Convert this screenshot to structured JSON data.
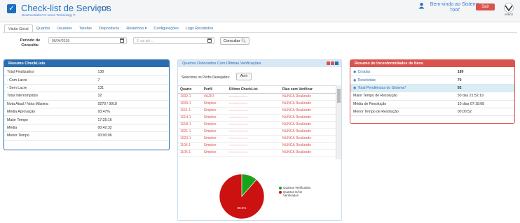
{
  "header": {
    "title": "Check-list de Serviços",
    "version": "v1.5",
    "subtitle": "Desenvolvido Por Vorce Technology ®",
    "welcome": "Bem-vindo ao Sistema 'root'",
    "logout_label": "Sair",
    "brand_logo": "VORCE"
  },
  "nav": {
    "tabs": [
      "Visão Geral",
      "Quartos",
      "Usuários",
      "Tarefas",
      "Dispositivos",
      "Relatórios ▾",
      "Configurações",
      "Logs Recebidos"
    ],
    "active_index": 0
  },
  "filter": {
    "period_label": "Período de Consulta:",
    "start_date": "06/04/2018",
    "end_placeholder": "E vai até ...",
    "consult_label": "Consultar"
  },
  "summary": {
    "title": "Resumo CheckLists",
    "rows": [
      {
        "label": "Total Finalizados",
        "value": "138"
      },
      {
        "label": "- Com Lacre",
        "value": "7"
      },
      {
        "label": "- Sem Lacre",
        "value": "131"
      },
      {
        "label": "Total Interrompidos",
        "value": "32"
      },
      {
        "label": "Nota Atual / Nota Máxima",
        "value": "9270 / 9918"
      },
      {
        "label": "Média Aprovação",
        "value": "93.47%"
      },
      {
        "label": "Maior Tempo",
        "value": "17:25:16"
      },
      {
        "label": "Média",
        "value": "00:42:32"
      },
      {
        "label": "Menor Tempo",
        "value": "00:00:06"
      }
    ]
  },
  "rooms": {
    "title": "Quartos Ordenados Com Últimas Verificações",
    "select_label": "Selecione os Perfis Desejados:",
    "open_label": "Abrir",
    "columns": [
      "Quarto",
      "Perfil",
      "Último CheckList",
      "Dias sem Verificar"
    ],
    "rows": [
      {
        "room": "1002-1",
        "profile": "VAZIO",
        "last": "----------------",
        "days": "NUNCA Realizado"
      },
      {
        "room": "1009-1",
        "profile": "Simples",
        "last": "----------------",
        "days": "NUNCA Realizado"
      },
      {
        "room": "1011-1",
        "profile": "Simples",
        "last": "----------------",
        "days": "NUNCA Realizado"
      },
      {
        "room": "1014-1",
        "profile": "Simples",
        "last": "----------------",
        "days": "NUNCA Realizado"
      },
      {
        "room": "1018-1",
        "profile": "Simples",
        "last": "----------------",
        "days": "NUNCA Realizado"
      },
      {
        "room": "1021-1",
        "profile": "Simples",
        "last": "----------------",
        "days": "NUNCA Realizado"
      },
      {
        "room": "1023-1",
        "profile": "Simples",
        "last": "----------------",
        "days": "NUNCA Realizado"
      },
      {
        "room": "1104-1",
        "profile": "Simples",
        "last": "----------------",
        "days": "NUNCA Realizado"
      },
      {
        "room": "1105-1",
        "profile": "Simples",
        "last": "----------------",
        "days": "NUNCA Realizado"
      }
    ],
    "pie": {
      "verified_pct": 0.114,
      "not_verified_label_value": "88.6%",
      "legend": [
        "Quartos Verificados",
        "Quartos NÃO Verificados"
      ],
      "colors": {
        "verified": "#1aa31a",
        "not_verified": "#cc1111"
      }
    }
  },
  "nonconformities": {
    "title": "Resumo de Inconformidades de Itens",
    "rows": [
      {
        "label": "Criadas",
        "value": "189",
        "link": true
      },
      {
        "label": "Resolvidas",
        "value": "70",
        "link": true
      },
      {
        "label": "Total Pendências do Sistema*",
        "value": "92",
        "link": true,
        "highlight": true
      },
      {
        "label": "Maior Tempo de Resolução",
        "value": "50 das 21:52:19"
      },
      {
        "label": "Média de Resolução",
        "value": "10 dias 07:18:08"
      },
      {
        "label": "Menor Tempo de Resolução",
        "value": "00:00:52"
      }
    ]
  },
  "colors": {
    "primary": "#2a6db0",
    "danger": "#d9534f",
    "info_bg": "#d9edf7"
  }
}
